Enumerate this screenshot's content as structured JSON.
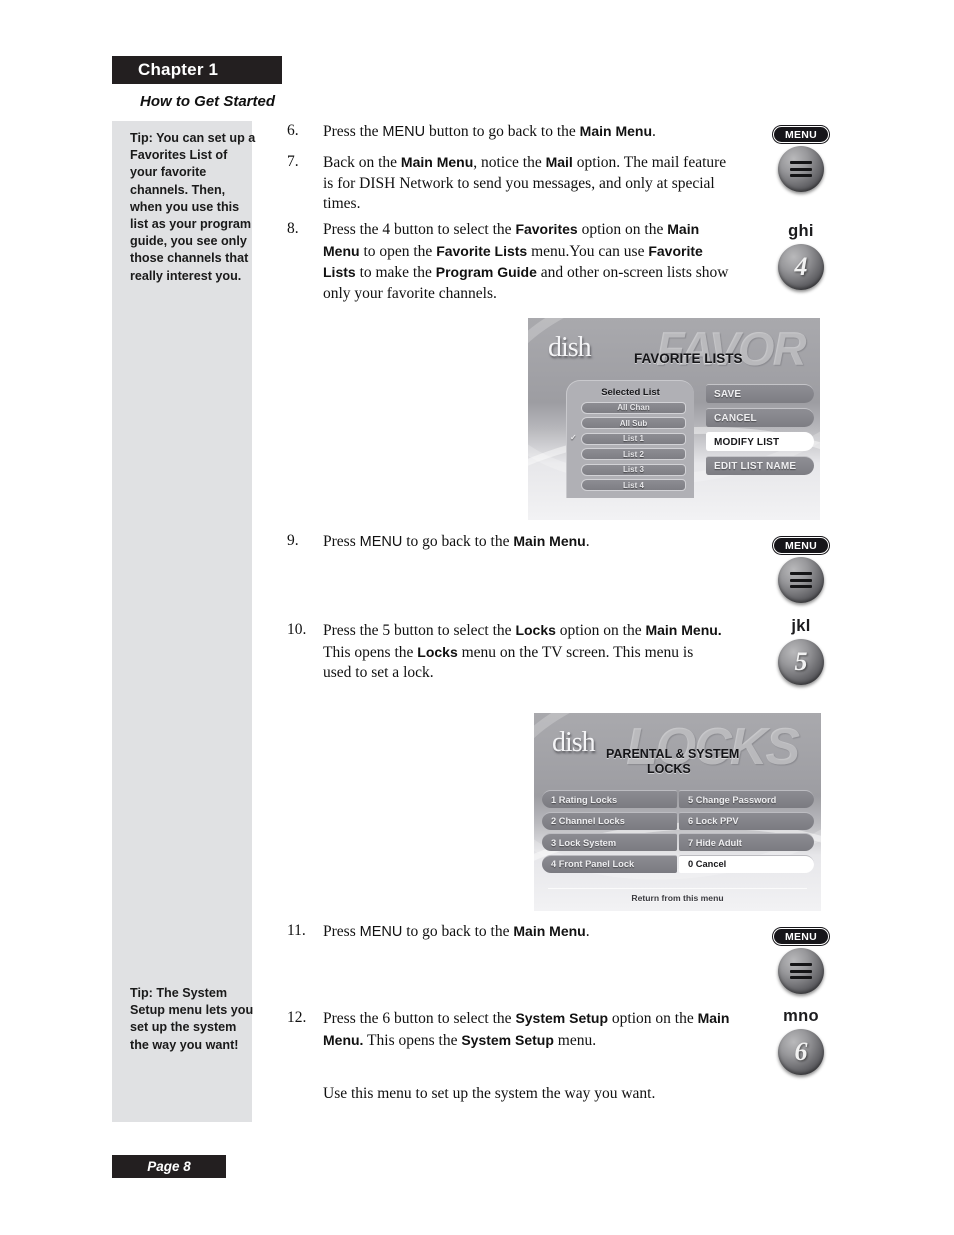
{
  "header": {
    "chapter": "Chapter 1",
    "subtitle": "How to Get Started"
  },
  "tips": [
    {
      "id": "tip-favorites",
      "text": "Tip: You can set up a Favorites List of your favorite channels. Then, when you use this list as your program guide, you see only those channels that really interest you."
    },
    {
      "id": "tip-system-setup",
      "text": "Tip: The System Setup menu lets you set up the system the way you want!"
    }
  ],
  "steps": [
    {
      "number": "6.",
      "parts": [
        {
          "t": "Press the ",
          "s": "roman"
        },
        {
          "t": "MENU",
          "s": "sans"
        },
        {
          "t": " button to go back to the ",
          "s": "roman"
        },
        {
          "t": "Main Menu",
          "s": "bold"
        },
        {
          "t": ".",
          "s": "roman"
        }
      ]
    },
    {
      "number": "7.",
      "parts": [
        {
          "t": "Back on the ",
          "s": "roman"
        },
        {
          "t": "Main Menu",
          "s": "bold"
        },
        {
          "t": ", notice the ",
          "s": "roman"
        },
        {
          "t": "Mail",
          "s": "bold"
        },
        {
          "t": " option. The mail feature is for DISH Network to send you messages, and only at special times.",
          "s": "roman"
        }
      ]
    },
    {
      "number": "8.",
      "parts": [
        {
          "t": "Press the 4 button to select the ",
          "s": "roman"
        },
        {
          "t": "Favorites",
          "s": "bold"
        },
        {
          "t": " option on the ",
          "s": "roman"
        },
        {
          "t": "Main Menu",
          "s": "bold"
        },
        {
          "t": " to open the ",
          "s": "roman"
        },
        {
          "t": "Favorite Lists",
          "s": "bold"
        },
        {
          "t": " menu.You can use ",
          "s": "roman"
        },
        {
          "t": "Favorite Lists",
          "s": "bold"
        },
        {
          "t": " to make the ",
          "s": "roman"
        },
        {
          "t": "Program Guide",
          "s": "bold"
        },
        {
          "t": " and other on-screen lists show only your favorite channels.",
          "s": "roman"
        }
      ]
    },
    {
      "number": "9.",
      "parts": [
        {
          "t": "Press ",
          "s": "roman"
        },
        {
          "t": "MENU",
          "s": "sans"
        },
        {
          "t": " to go back to the ",
          "s": "roman"
        },
        {
          "t": "Main Menu",
          "s": "bold"
        },
        {
          "t": ".",
          "s": "roman"
        }
      ]
    },
    {
      "number": "10.",
      "parts": [
        {
          "t": "Press the 5 button to select the ",
          "s": "roman"
        },
        {
          "t": "Locks",
          "s": "bold"
        },
        {
          "t": " option on the ",
          "s": "roman"
        },
        {
          "t": "Main Menu.",
          "s": "bold"
        },
        {
          "t": " This opens the ",
          "s": "roman"
        },
        {
          "t": "Locks",
          "s": "bold"
        },
        {
          "t": " menu on the TV screen. This menu is used to set a lock.",
          "s": "roman"
        }
      ]
    },
    {
      "number": "11.",
      "parts": [
        {
          "t": "Press ",
          "s": "roman"
        },
        {
          "t": "MENU",
          "s": "sans"
        },
        {
          "t": " to go back to the ",
          "s": "roman"
        },
        {
          "t": "Main Menu",
          "s": "bold"
        },
        {
          "t": ".",
          "s": "roman"
        }
      ]
    },
    {
      "number": "12.",
      "parts": [
        {
          "t": "Press the 6 button to select the ",
          "s": "roman"
        },
        {
          "t": "System Setup",
          "s": "bold"
        },
        {
          "t": " option on the ",
          "s": "roman"
        },
        {
          "t": "Main Menu.",
          "s": "bold"
        },
        {
          "t": " This opens the ",
          "s": "roman"
        },
        {
          "t": "System Setup",
          "s": "bold"
        },
        {
          "t": " menu.",
          "s": "roman"
        }
      ]
    }
  ],
  "closing_text": "Use this menu to set up the system the way you want.",
  "remote_keys": [
    {
      "id": "menu-1",
      "type": "menu",
      "label": "MENU",
      "icon": "hamburger-menu-icon"
    },
    {
      "id": "key-4",
      "type": "digit",
      "letters": "ghi",
      "digit": "4"
    },
    {
      "id": "menu-2",
      "type": "menu",
      "label": "MENU",
      "icon": "hamburger-menu-icon"
    },
    {
      "id": "key-5",
      "type": "digit",
      "letters": "jkl",
      "digit": "5"
    },
    {
      "id": "menu-3",
      "type": "menu",
      "label": "MENU",
      "icon": "hamburger-menu-icon"
    },
    {
      "id": "key-6",
      "type": "digit",
      "letters": "mno",
      "digit": "6"
    }
  ],
  "tv_favorites": {
    "logo": "dish",
    "ghost_word": "FAVOR",
    "title": "FAVORITE LISTS",
    "panel_title": "Selected List",
    "lists": [
      {
        "label": "All Chan",
        "checked": false
      },
      {
        "label": "All Sub",
        "checked": false
      },
      {
        "label": "List 1",
        "checked": true
      },
      {
        "label": "List 2",
        "checked": false
      },
      {
        "label": "List 3",
        "checked": false
      },
      {
        "label": "List 4",
        "checked": false
      }
    ],
    "actions": [
      {
        "label": "SAVE",
        "selected": false
      },
      {
        "label": "CANCEL",
        "selected": false
      },
      {
        "label": "MODIFY LIST",
        "selected": true
      },
      {
        "label": "EDIT LIST NAME",
        "selected": false
      }
    ]
  },
  "tv_locks": {
    "logo": "dish",
    "ghost_word": "LOCKS",
    "title_line1": "PARENTAL & SYSTEM",
    "title_line2": "LOCKS",
    "rows": [
      {
        "left": {
          "label": "1 Rating Locks",
          "selected": false
        },
        "right": {
          "label": "5 Change Password",
          "selected": false
        }
      },
      {
        "left": {
          "label": "2 Channel Locks",
          "selected": false
        },
        "right": {
          "label": "6  Lock PPV",
          "selected": false
        }
      },
      {
        "left": {
          "label": "3  Lock System",
          "selected": false
        },
        "right": {
          "label": "7  Hide Adult",
          "selected": false
        }
      },
      {
        "left": {
          "label": "4 Front Panel Lock",
          "selected": false
        },
        "right": {
          "label": "0  Cancel",
          "selected": true
        }
      }
    ],
    "footer": "Return from this menu"
  },
  "footer": {
    "page_label": "Page 8"
  },
  "colors": {
    "bar_black": "#231f20",
    "tip_gray": "#e0e1e3",
    "text": "#111111"
  }
}
